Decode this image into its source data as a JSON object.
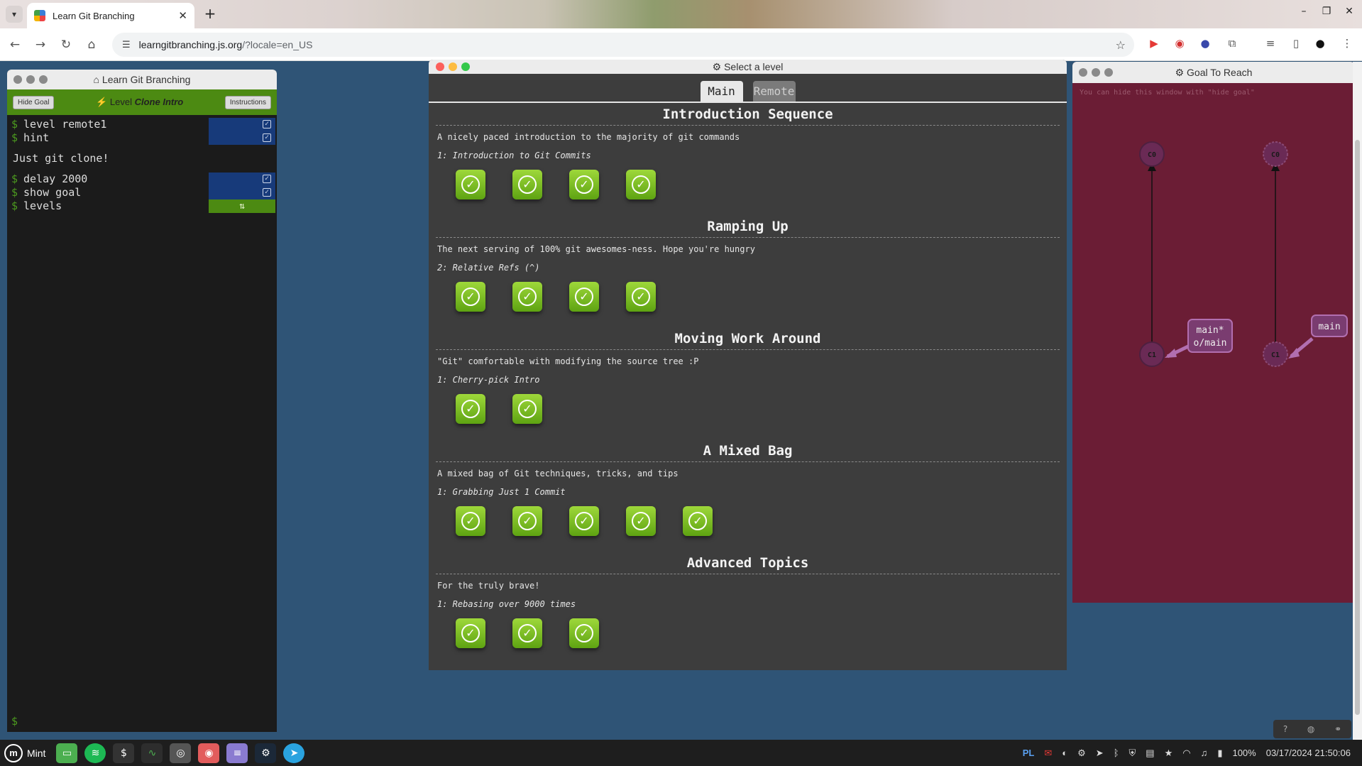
{
  "browser": {
    "tab_title": "Learn Git Branching",
    "url_host": "learngitbranching.js.org",
    "url_path": "/?locale=en_US"
  },
  "terminal": {
    "title": "Learn Git Branching",
    "hide_goal_label": "Hide Goal",
    "level_prefix": "Level",
    "level_name": "Clone Intro",
    "instructions_label": "Instructions",
    "commands_a": [
      {
        "text": "level remote1"
      },
      {
        "text": "hint"
      }
    ],
    "output": "Just git clone!",
    "commands_b": [
      {
        "text": "delay 2000"
      },
      {
        "text": "show goal"
      },
      {
        "text": "levels"
      }
    ],
    "prompt": "$"
  },
  "level_select": {
    "title": "Select a level",
    "tabs": [
      {
        "label": "Main",
        "active": true
      },
      {
        "label": "Remote",
        "active": false
      }
    ],
    "sections": [
      {
        "title": "Introduction Sequence",
        "desc": "A nicely paced introduction to the majority of git commands",
        "sub": "1: Introduction to Git Commits",
        "count": 4
      },
      {
        "title": "Ramping Up",
        "desc": "The next serving of 100% git awesomes-ness. Hope you're hungry",
        "sub": "2: Relative Refs (^)",
        "count": 4
      },
      {
        "title": "Moving Work Around",
        "desc": "\"Git\" comfortable with modifying the source tree :P",
        "sub": "1: Cherry-pick Intro",
        "count": 2
      },
      {
        "title": "A Mixed Bag",
        "desc": "A mixed bag of Git techniques, tricks, and tips",
        "sub": "1: Grabbing Just 1 Commit",
        "count": 5
      },
      {
        "title": "Advanced Topics",
        "desc": "For the truly brave!",
        "sub": "1: Rebasing over 9000 times",
        "count": 3
      }
    ]
  },
  "goal": {
    "title": "Goal To Reach",
    "hint": "You can hide this window with \"hide goal\"",
    "local": {
      "c0": "C0",
      "c1": "C1",
      "branch_line1": "main*",
      "branch_line2": "o/main"
    },
    "remote": {
      "c0": "C0",
      "c1": "C1",
      "branch": "main"
    }
  },
  "taskbar": {
    "menu_label": "Mint",
    "lang": "PL",
    "battery": "100%",
    "clock": "03/17/2024 21:50:06"
  },
  "colors": {
    "page_bg": "#2f5476",
    "goal_bg": "#6b1d35",
    "terminal_accent": "#4c8a12",
    "level_done": "#7cc12a"
  }
}
